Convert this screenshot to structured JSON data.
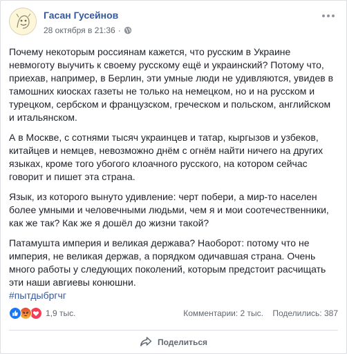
{
  "post": {
    "author": "Гасан Гусейнов",
    "timestamp": "28 октября в 21:36",
    "separator": "·",
    "privacy_icon": "globe-icon",
    "paragraphs": [
      "Почему некоторым россиянам кажется, что русским в Украине невмоготу выучить к своему русскому ещё и украинский? Потому что, приехав, например, в Берлин, эти умные люди не удивляются, увидев в тамошних киосках газеты не только на немецком, но и на русском и турецком, сербском и французском, греческом и польском, английском и итальянском.",
      "А в Москве, с сотнями тысяч украинцев и татар, кыргызов и узбеков, китайцев и немцев, невозможно днём с огнём найти ничего на других языках, кроме того убогого клоачного русского, на котором сейчас говорит и пишет эта страна.",
      "Язык, из которого вынуто удивление: черт побери, а мир-то населен более умными и человечными людьми, чем я и мои соотечественники, как же так? Как же я дошёл до жизни такой?",
      "Патамушта империя и великая держава? Наоборот: потому что не империя, не великая держав, а порядком одичавшая страна. Очень много работы у следующих поколений, которым предстоит расчищать эти наши авгиевы конюшни."
    ],
    "hashtag": "#пытдыбргчг"
  },
  "stats": {
    "reaction_icons": [
      "like-icon",
      "angry-icon",
      "love-icon"
    ],
    "reaction_count": "1,9 тыс.",
    "comments": "Комментарии: 2 тыс.",
    "shares": "Поделились: 387"
  },
  "actions": {
    "share_label": "Поделиться"
  },
  "colors": {
    "link": "#365899",
    "text": "#1d2129",
    "muted": "#616770",
    "like": "#1877f2",
    "angry": "#e9710f",
    "love": "#f33e58"
  }
}
